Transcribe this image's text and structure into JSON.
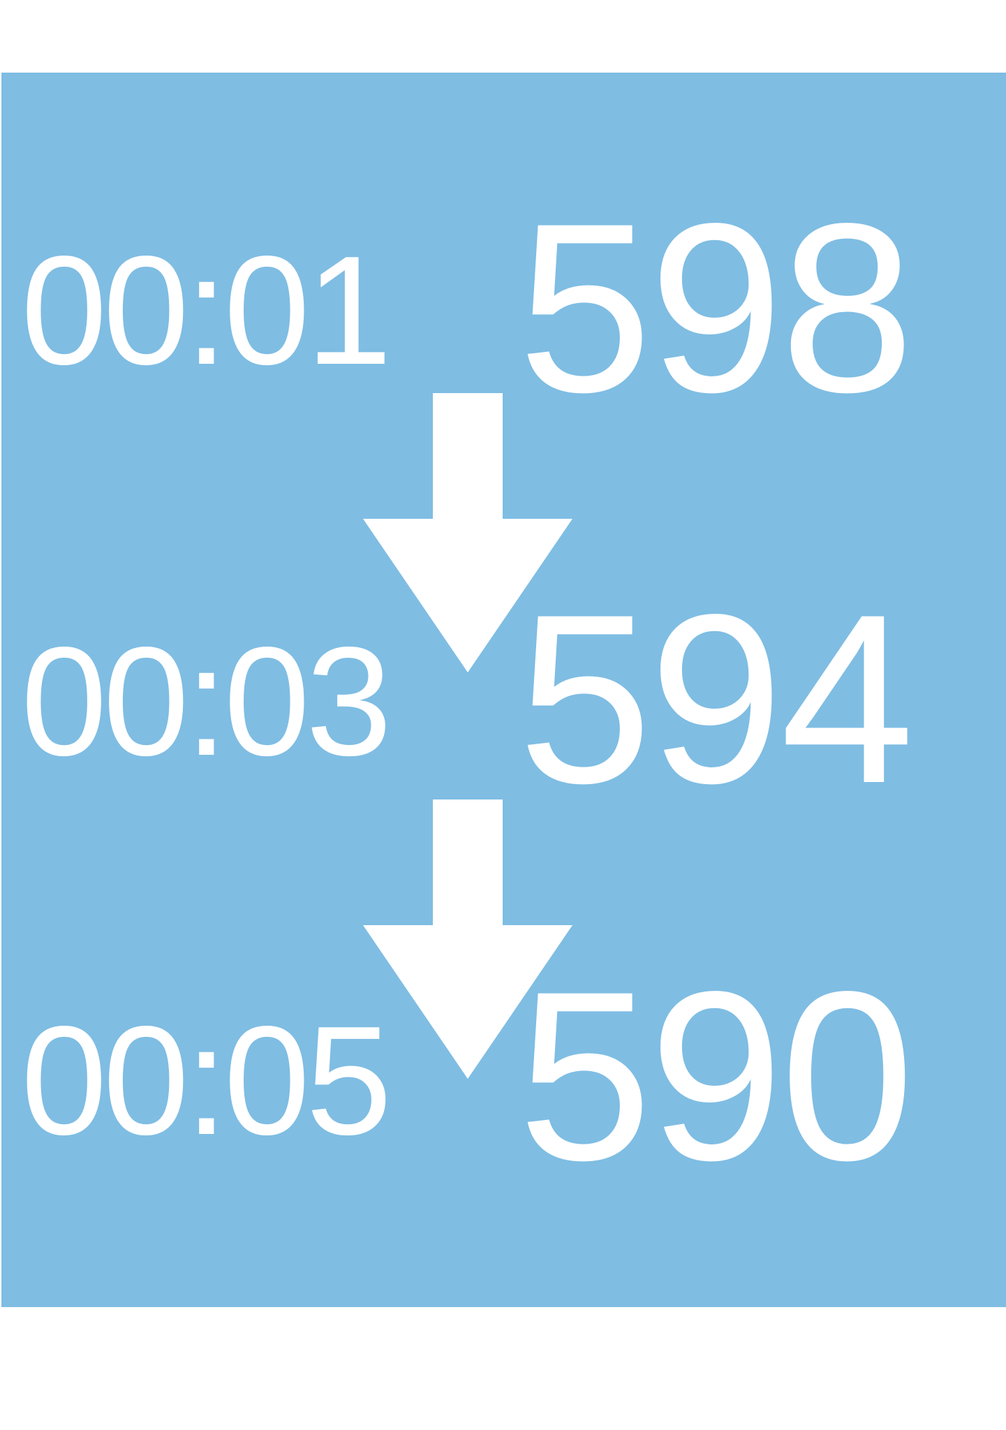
{
  "readings": [
    {
      "time": "00:01",
      "count": "598"
    },
    {
      "time": "00:03",
      "count": "594"
    },
    {
      "time": "00:05",
      "count": "590"
    }
  ],
  "arrows": [
    "down-arrow-icon",
    "down-arrow-icon"
  ],
  "colors": {
    "panel_background": "#7fbde3",
    "foreground": "#ffffff",
    "page_background": "#ffffff"
  }
}
